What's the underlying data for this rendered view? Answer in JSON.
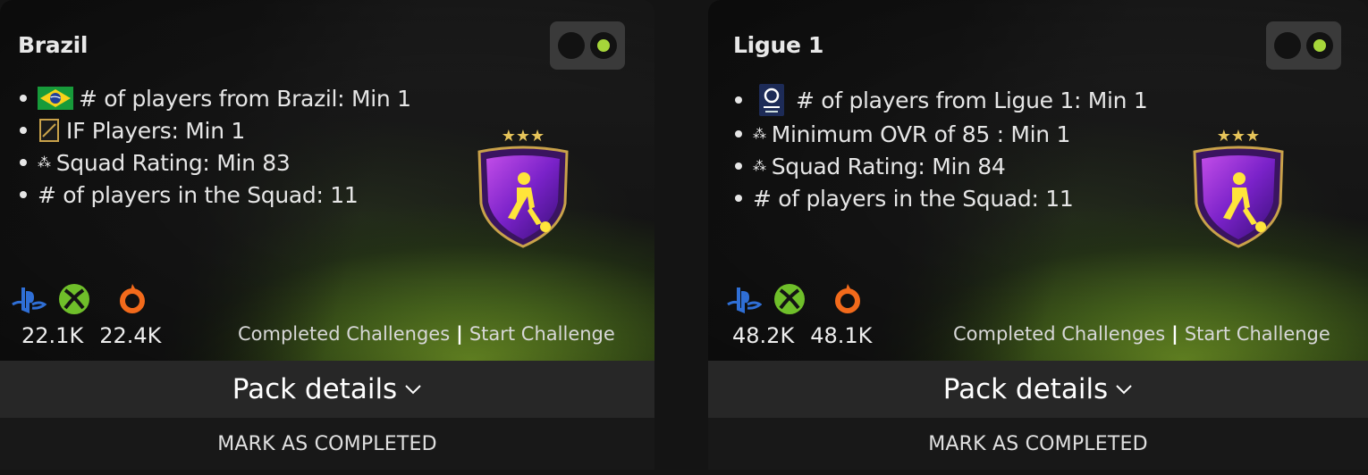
{
  "cards": [
    {
      "title": "Brazil",
      "toggle": "on",
      "requirements": [
        {
          "icon": "brazil-flag-icon",
          "text": "# of players from Brazil: Min 1"
        },
        {
          "icon": "if-card-icon",
          "text": "IF Players: Min 1"
        },
        {
          "icon": "stars-icon",
          "text": "Squad Rating: Min 83"
        },
        {
          "icon": "none",
          "text": "# of players in the Squad: 11"
        }
      ],
      "platform_icons": [
        "playstation-icon",
        "xbox-icon",
        "origin-icon"
      ],
      "counts": [
        "22.1K",
        "22.4K"
      ],
      "completed_label": "Completed Challenges",
      "separator": "|",
      "start_label": "Start Challenge",
      "pack_details_label": "Pack details",
      "mark_completed_label": "MARK AS COMPLETED"
    },
    {
      "title": "Ligue 1",
      "toggle": "on",
      "requirements": [
        {
          "icon": "ligue1-logo-icon",
          "text": "# of players from Ligue 1: Min 1"
        },
        {
          "icon": "stars-icon",
          "text": "Minimum OVR of 85 : Min 1"
        },
        {
          "icon": "stars-icon",
          "text": "Squad Rating: Min 84"
        },
        {
          "icon": "none",
          "text": "# of players in the Squad: 11"
        }
      ],
      "platform_icons": [
        "playstation-icon",
        "xbox-icon",
        "origin-icon"
      ],
      "counts": [
        "48.2K",
        "48.1K"
      ],
      "completed_label": "Completed Challenges",
      "separator": "|",
      "start_label": "Start Challenge",
      "pack_details_label": "Pack details",
      "mark_completed_label": "MARK AS COMPLETED"
    }
  ],
  "colors": {
    "toggle_on": "#a6d63a",
    "playstation": "#2f6fd6",
    "xbox": "#6fbf2a",
    "origin": "#f26a1b",
    "badge_purple": "#8a2be2",
    "badge_gold": "#c9a24a"
  }
}
